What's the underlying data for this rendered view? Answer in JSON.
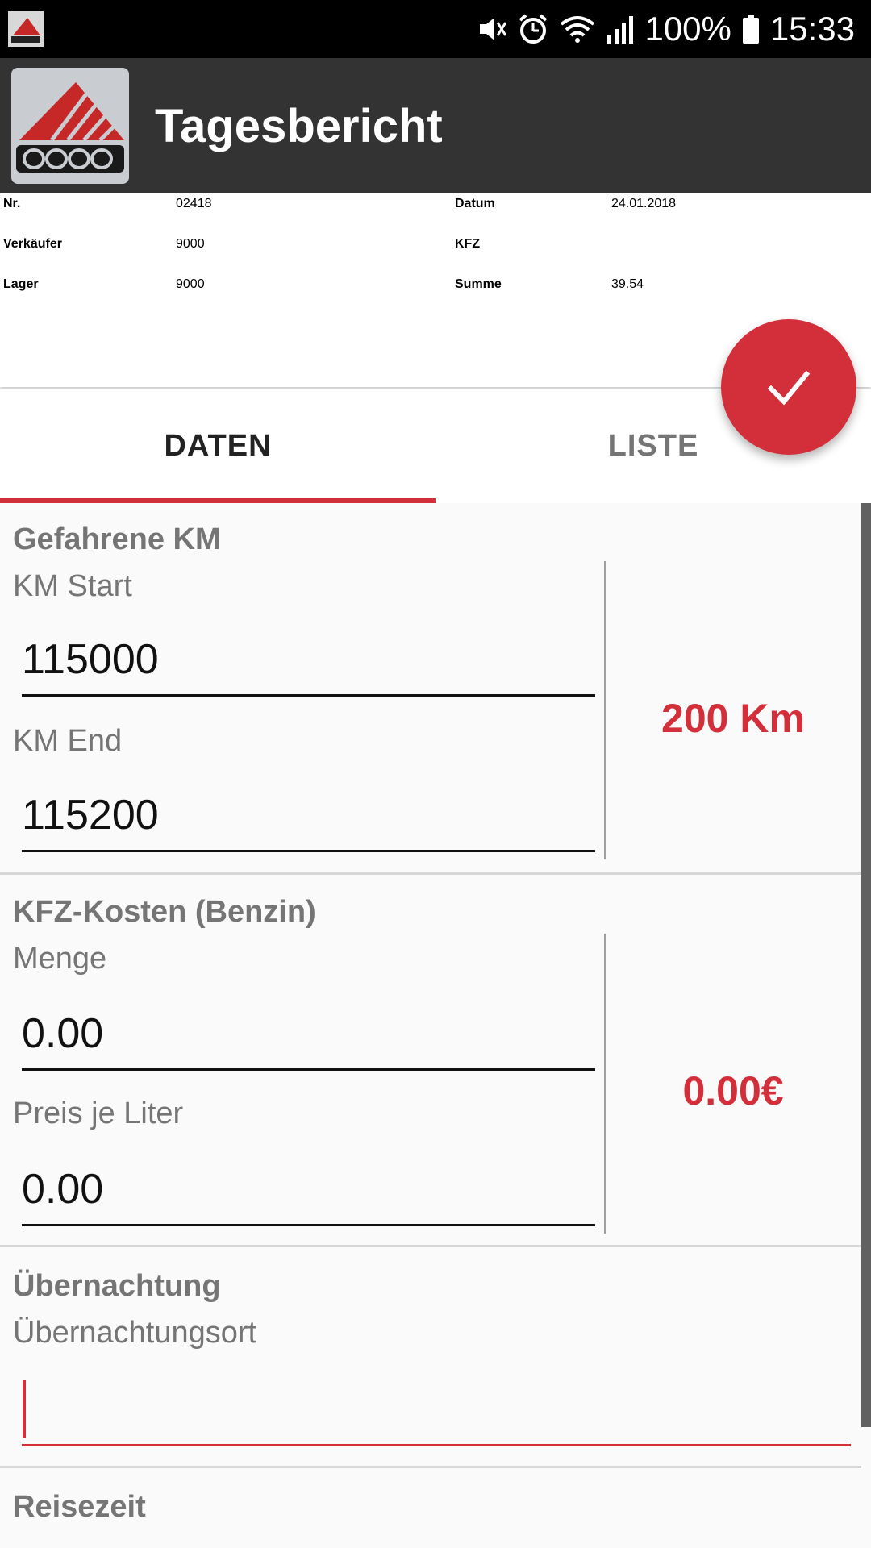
{
  "status_bar": {
    "battery": "100%",
    "time": "15:33"
  },
  "app_bar": {
    "title": "Tagesbericht",
    "logo_icon": "cosys-logo"
  },
  "header": {
    "nr_label": "Nr.",
    "nr_value": "02418",
    "verkaeufer_label": "Verkäufer",
    "verkaeufer_value": "9000",
    "lager_label": "Lager",
    "lager_value": "9000",
    "datum_label": "Datum",
    "datum_value": "24.01.2018",
    "kfz_label": "KFZ",
    "kfz_value": "",
    "summe_label": "Summe",
    "summe_value": "39.54"
  },
  "fab": {
    "icon": "check-icon"
  },
  "tabs": [
    {
      "label": "DATEN",
      "active": true
    },
    {
      "label": "LISTE",
      "active": false
    }
  ],
  "sections": {
    "km": {
      "title": "Gefahrene KM",
      "start_label": "KM Start",
      "start_value": "115000",
      "end_label": "KM End",
      "end_value": "115200",
      "result": "200 Km"
    },
    "kfz_kosten": {
      "title": "KFZ-Kosten (Benzin)",
      "menge_label": "Menge",
      "menge_value": "0.00",
      "preis_label": "Preis je Liter",
      "preis_value": "0.00",
      "result": "0.00€"
    },
    "uebernachtung": {
      "title": "Übernachtung",
      "ort_label": "Übernachtungsort",
      "ort_value": ""
    },
    "reisezeit": {
      "title": "Reisezeit"
    }
  },
  "colors": {
    "accent": "#d32f3a",
    "app_bar": "#333333",
    "status_bar": "#000000"
  }
}
